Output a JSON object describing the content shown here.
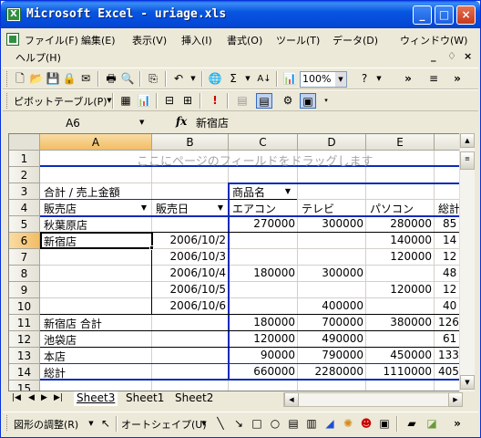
{
  "window": {
    "title": "Microsoft Excel - uriage.xls",
    "minimize": "_",
    "maximize": "□",
    "close": "×"
  },
  "menu": {
    "items": [
      "ファイル(F)",
      "編集(E)",
      "表示(V)",
      "挿入(I)",
      "書式(O)",
      "ツール(T)",
      "データ(D)",
      "ウィンドウ(W)"
    ],
    "help": "ヘルプ(H)",
    "mdi_min": "_",
    "mdi_restore": "♢",
    "mdi_close": "×"
  },
  "toolbar": {
    "zoom": "100%",
    "sum": "Σ",
    "pivot_label": "ピボットテーブル(P)",
    "more": "»"
  },
  "formula_bar": {
    "name_box": "A6",
    "fx": "fx",
    "value": "新宿店"
  },
  "columns": [
    "A",
    "B",
    "C",
    "D",
    "E"
  ],
  "rows": [
    "1",
    "2",
    "3",
    "4",
    "5",
    "6",
    "7",
    "8",
    "9",
    "10",
    "11",
    "12",
    "13",
    "14",
    "15"
  ],
  "active_cell": "A6",
  "pivot": {
    "page_area_hint": "ここにページのフィールドをドラッグします",
    "data_field": "合計 / 売上金額",
    "column_field": "商品名",
    "row_fields": [
      "販売店",
      "販売日"
    ],
    "products": [
      "エアコン",
      "テレビ",
      "パソコン",
      "総計"
    ],
    "rows": [
      {
        "store": "秋葉原店",
        "date": "",
        "values": [
          "270000",
          "300000",
          "280000",
          "85"
        ]
      },
      {
        "store": "新宿店",
        "date": "2006/10/2",
        "values": [
          "",
          "",
          "140000",
          "14"
        ]
      },
      {
        "store": "",
        "date": "2006/10/3",
        "values": [
          "",
          "",
          "120000",
          "12"
        ]
      },
      {
        "store": "",
        "date": "2006/10/4",
        "values": [
          "180000",
          "300000",
          "",
          "48"
        ]
      },
      {
        "store": "",
        "date": "2006/10/5",
        "values": [
          "",
          "",
          "120000",
          "12"
        ]
      },
      {
        "store": "",
        "date": "2006/10/6",
        "values": [
          "",
          "400000",
          "",
          "40"
        ]
      },
      {
        "store": "新宿店 合計",
        "date": "",
        "values": [
          "180000",
          "700000",
          "380000",
          "126"
        ]
      },
      {
        "store": "池袋店",
        "date": "",
        "values": [
          "120000",
          "490000",
          "",
          "61"
        ]
      },
      {
        "store": "本店",
        "date": "",
        "values": [
          "90000",
          "790000",
          "450000",
          "133"
        ]
      },
      {
        "store": "総計",
        "date": "",
        "values": [
          "660000",
          "2280000",
          "1110000",
          "405"
        ]
      }
    ]
  },
  "sheet_tabs": [
    "Sheet3",
    "Sheet1",
    "Sheet2"
  ],
  "active_sheet": "Sheet3",
  "drawing": {
    "adjust": "図形の調整(R)",
    "autoshape": "オートシェイプ(U)"
  }
}
